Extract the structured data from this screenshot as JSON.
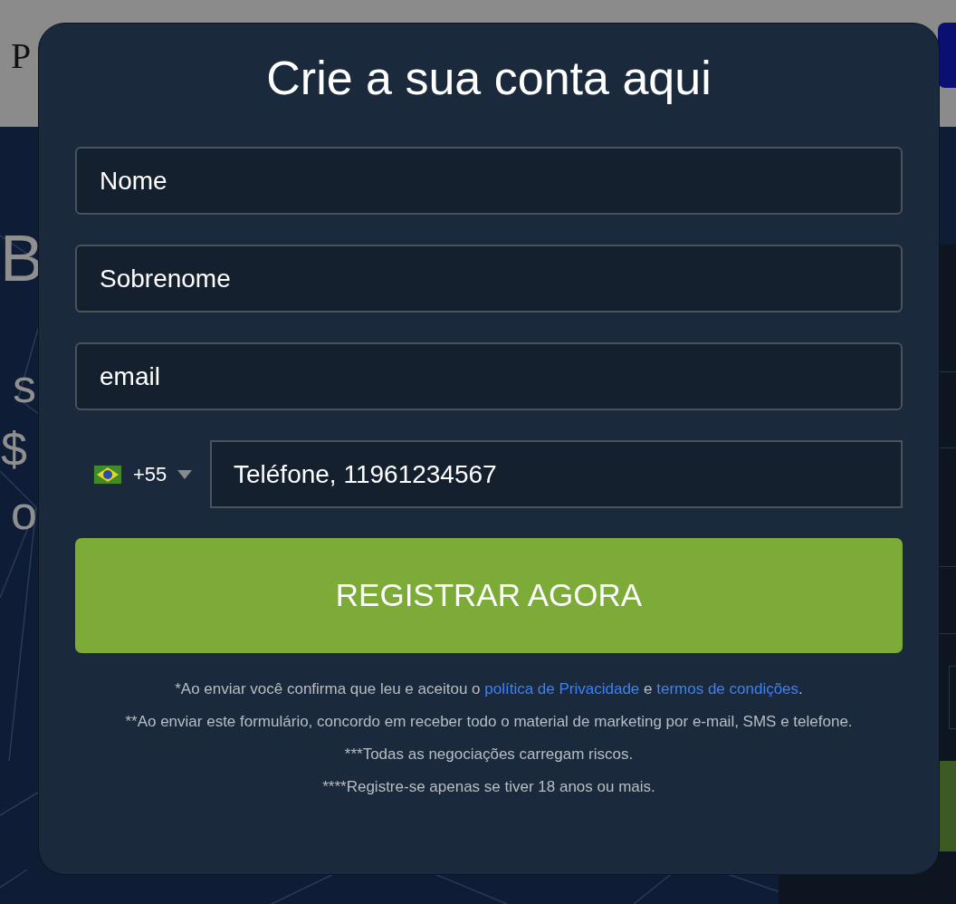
{
  "background_page": {
    "header_text": "P",
    "left_texts": [
      "B",
      "s",
      "$",
      "o"
    ]
  },
  "modal": {
    "title": "Crie a sua conta aqui",
    "fields": [
      {
        "placeholder": "Nome"
      },
      {
        "placeholder": "Sobrenome"
      },
      {
        "placeholder": "email"
      }
    ],
    "phone": {
      "country_code": "+55",
      "placeholder": "Teléfone, 11961234567"
    },
    "submit_button": "REGISTRAR AGORA",
    "notes": [
      {
        "parts": [
          {
            "kind": "text",
            "text": "*Ao enviar você confirma que leu e aceitou o "
          },
          {
            "kind": "link",
            "text": "política de Privacidade"
          },
          {
            "kind": "text",
            "text": " e "
          },
          {
            "kind": "link",
            "text": "termos de condições"
          },
          {
            "kind": "text",
            "text": "."
          }
        ]
      },
      {
        "parts": [
          {
            "kind": "text",
            "text": "**Ao enviar este formulário, concordo em receber todo o material de marketing por e-mail, SMS e telefone."
          }
        ]
      },
      {
        "parts": [
          {
            "kind": "text",
            "text": "***Todas as negociações carregam riscos."
          }
        ]
      },
      {
        "parts": [
          {
            "kind": "text",
            "text": "****Registre-se apenas se tiver 18 anos ou mais."
          }
        ]
      }
    ]
  }
}
